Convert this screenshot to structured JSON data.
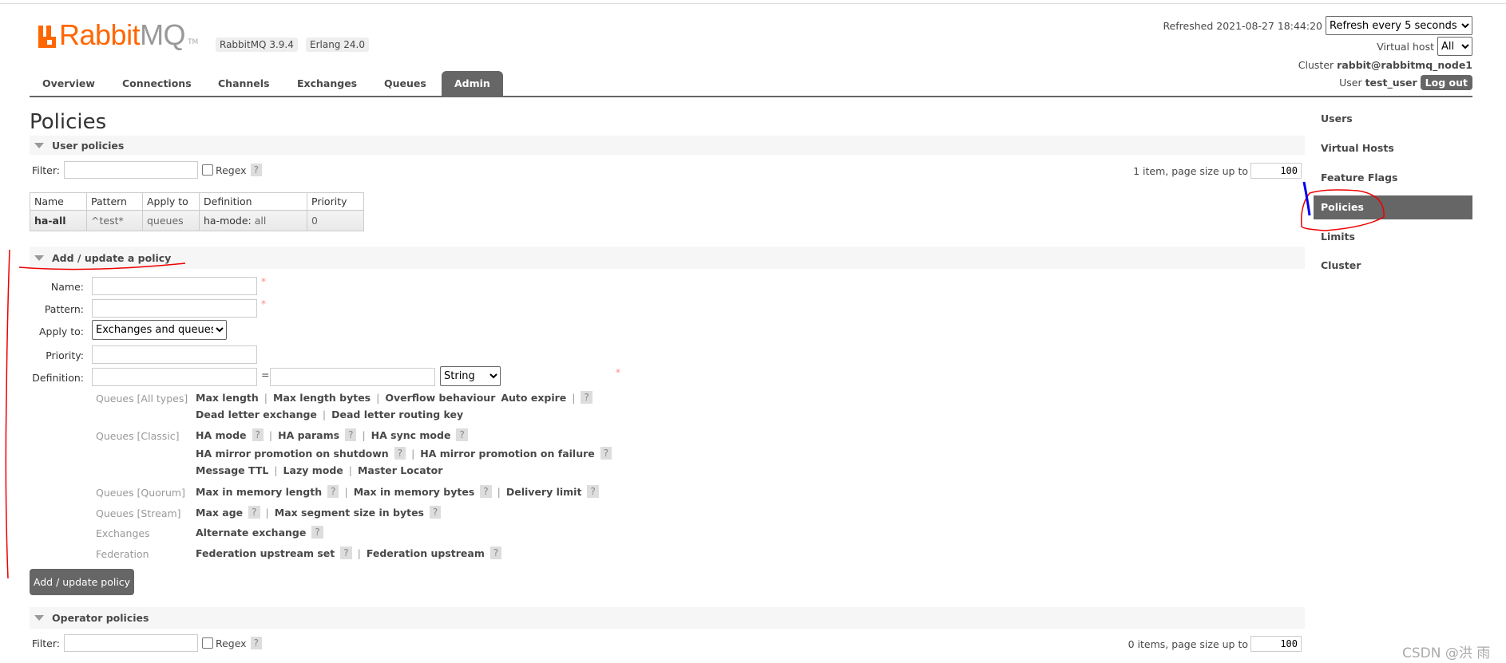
{
  "header": {
    "logo_text_a": "Rabbit",
    "logo_text_b": "MQ",
    "logo_tm": "TM",
    "version_badge": "RabbitMQ 3.9.4",
    "erlang_badge": "Erlang 24.0",
    "refreshed_label": "Refreshed 2021-08-27 18:44:20",
    "refresh_select": "Refresh every 5 seconds",
    "vhost_label": "Virtual host",
    "vhost_select": "All",
    "cluster_label": "Cluster",
    "cluster_value": "rabbit@rabbitmq_node1",
    "user_label": "User",
    "user_value": "test_user",
    "logout_label": "Log out"
  },
  "nav": {
    "tabs": [
      "Overview",
      "Connections",
      "Channels",
      "Exchanges",
      "Queues",
      "Admin"
    ],
    "active": "Admin"
  },
  "page_title": "Policies",
  "user_policies": {
    "title": "User policies",
    "filter_label": "Filter:",
    "filter_value": "",
    "regex_label": "Regex",
    "help": "?",
    "count_text": "1 item, page size up to",
    "page_size": "100",
    "columns": [
      "Name",
      "Pattern",
      "Apply to",
      "Definition",
      "Priority"
    ],
    "rows": [
      {
        "name": "ha-all",
        "pattern": "^test*",
        "apply_to": "queues",
        "def_key": "ha-mode:",
        "def_value": "all",
        "priority": "0"
      }
    ]
  },
  "add_policy": {
    "title": "Add / update a policy",
    "name_label": "Name:",
    "pattern_label": "Pattern:",
    "apply_label": "Apply to:",
    "apply_value": "Exchanges and queues",
    "priority_label": "Priority:",
    "definition_label": "Definition:",
    "equals": "=",
    "type_value": "String",
    "required_mark": "*",
    "groups": [
      {
        "label": "Queues [All types]",
        "lines": [
          [
            "Max length",
            "|",
            "Max length bytes",
            "|",
            "Overflow behaviour",
            "Auto expire",
            "|",
            "?"
          ],
          [
            "Dead letter exchange",
            "|",
            "Dead letter routing key"
          ]
        ]
      },
      {
        "label": "Queues [Classic]",
        "lines": [
          [
            "HA mode",
            "?",
            "|",
            "HA params",
            "?",
            "|",
            "HA sync mode",
            "?"
          ],
          [
            "HA mirror promotion on shutdown",
            "?",
            "|",
            "HA mirror promotion on failure",
            "?"
          ],
          [
            "Message TTL",
            "|",
            "Lazy mode",
            "|",
            "Master Locator"
          ]
        ]
      },
      {
        "label": "Queues [Quorum]",
        "lines": [
          [
            "Max in memory length",
            "?",
            "|",
            "Max in memory bytes",
            "?",
            "|",
            "Delivery limit",
            "?"
          ]
        ]
      },
      {
        "label": "Queues [Stream]",
        "lines": [
          [
            "Max age",
            "?",
            "|",
            "Max segment size in bytes",
            "?"
          ]
        ]
      },
      {
        "label": "Exchanges",
        "lines": [
          [
            "Alternate exchange",
            "?"
          ]
        ]
      },
      {
        "label": "Federation",
        "lines": [
          [
            "Federation upstream set",
            "?",
            "|",
            "Federation upstream",
            "?"
          ]
        ]
      }
    ],
    "submit_label": "Add / update policy"
  },
  "operator_policies": {
    "title": "Operator policies",
    "filter_label": "Filter:",
    "regex_label": "Regex",
    "help": "?",
    "count_text": "0 items, page size up to",
    "page_size": "100"
  },
  "sidebar": {
    "items": [
      "Users",
      "Virtual Hosts",
      "Feature Flags",
      "Policies",
      "Limits",
      "Cluster"
    ],
    "active": "Policies"
  },
  "watermark": "CSDN @洪 雨",
  "colors": {
    "brand": "#ff6600",
    "accent": "#666666",
    "annotation_red": "#e00000",
    "annotation_blue": "#0000ee"
  }
}
